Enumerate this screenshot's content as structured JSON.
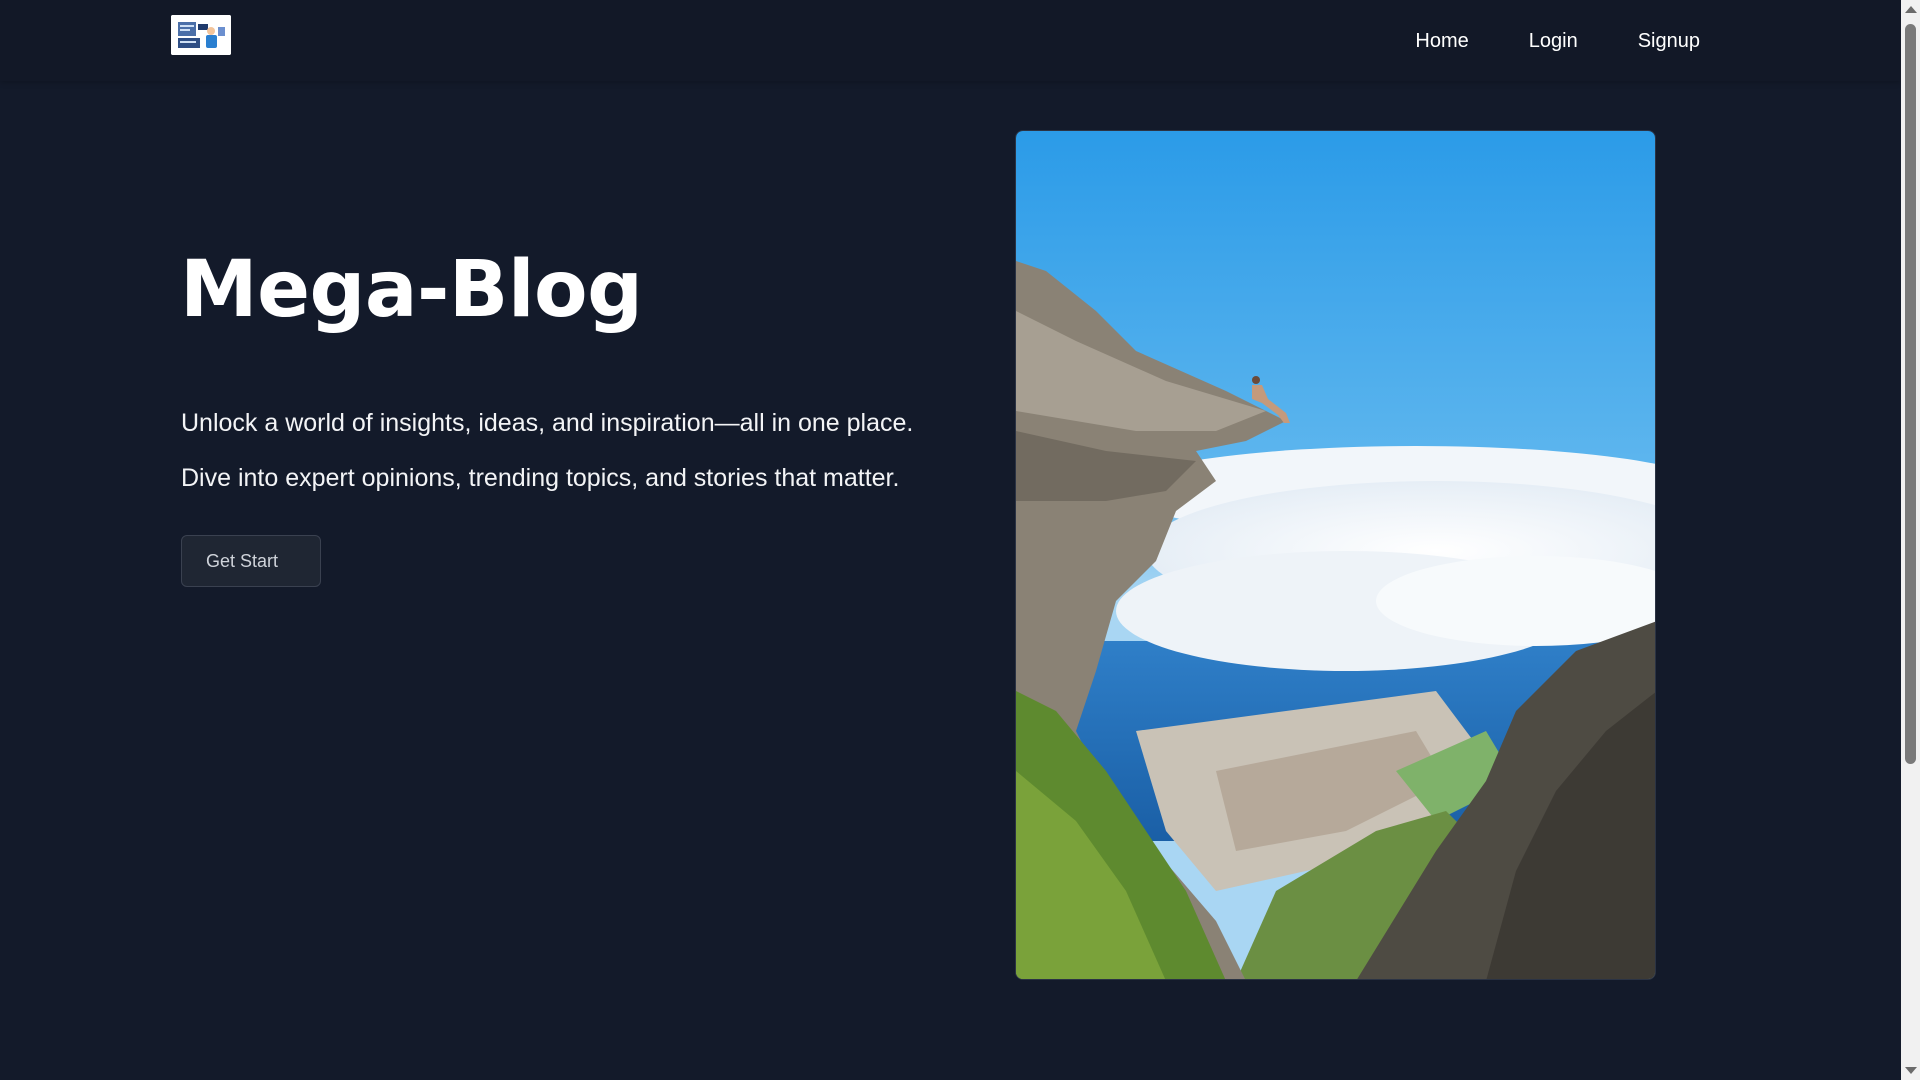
{
  "header": {
    "logo_icon": "blog-logo-icon",
    "nav": {
      "home": "Home",
      "login": "Login",
      "signup": "Signup"
    }
  },
  "hero": {
    "title": "Mega-Blog",
    "line1": "Unlock a world of insights, ideas, and inspiration—all in one place.",
    "line2": "Dive into expert opinions, trending topics, and stories that matter.",
    "cta": "Get Start"
  },
  "colors": {
    "background": "#131a2a",
    "header": "#121827",
    "button_bg": "#1f2633"
  }
}
